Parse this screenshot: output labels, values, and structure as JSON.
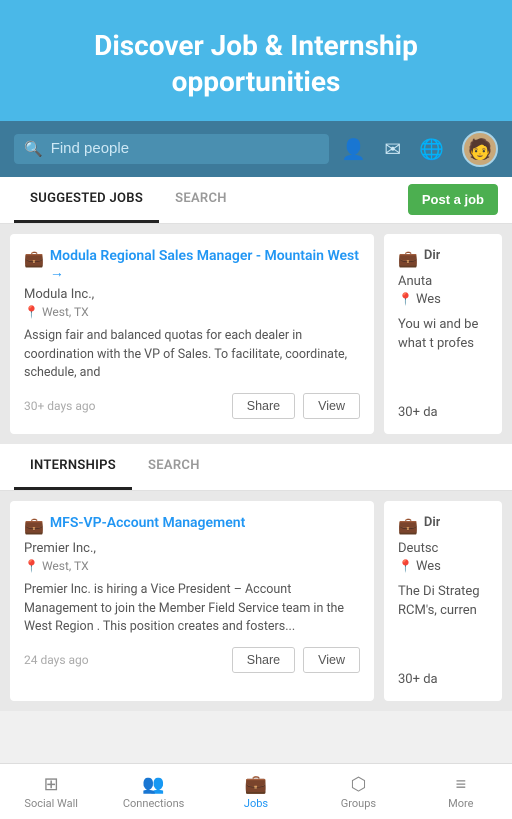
{
  "hero": {
    "title": "Discover Job & Internship opportunities"
  },
  "search": {
    "placeholder": "Find people"
  },
  "tabs_jobs": {
    "tab1": "SUGGESTED JOBS",
    "tab2": "SEARCH",
    "post_button": "Post a job"
  },
  "tabs_internships": {
    "tab1": "INTERNSHIPS",
    "tab2": "SEARCH"
  },
  "job1": {
    "title": "Modula Regional Sales Manager - Mountain West →",
    "company": "Modula Inc.,",
    "location": "West, TX",
    "description": "Assign fair and balanced quotas for each dealer in coordination with the VP of Sales. To facilitate, coordinate, schedule, and",
    "days_ago": "30+ days ago",
    "share": "Share",
    "view": "View"
  },
  "job2": {
    "title": "Dir",
    "company": "Anuta",
    "location": "Wes",
    "description": "You wi and be what t profes",
    "days_ago": "30+ da"
  },
  "internship1": {
    "title": "MFS-VP-Account Management",
    "company": "Premier Inc.,",
    "location": "West, TX",
    "description": "Premier Inc. is hiring a Vice President – Account Management to join the Member Field Service team in the West Region . This position creates and fosters...",
    "days_ago": "24 days ago",
    "share": "Share",
    "view": "View"
  },
  "internship2": {
    "title": "Dir",
    "company": "Deutsc",
    "location": "Wes",
    "description": "The Di Strateg RCM's, curren",
    "days_ago": "30+ da"
  },
  "bottom_nav": {
    "items": [
      {
        "id": "social-wall",
        "label": "Social Wall",
        "icon": "⊞",
        "active": false
      },
      {
        "id": "connections",
        "label": "Connections",
        "icon": "👥",
        "active": false
      },
      {
        "id": "jobs",
        "label": "Jobs",
        "icon": "💼",
        "active": true
      },
      {
        "id": "groups",
        "label": "Groups",
        "icon": "⬡",
        "active": false
      },
      {
        "id": "more",
        "label": "More",
        "icon": "≡",
        "active": false
      }
    ]
  }
}
